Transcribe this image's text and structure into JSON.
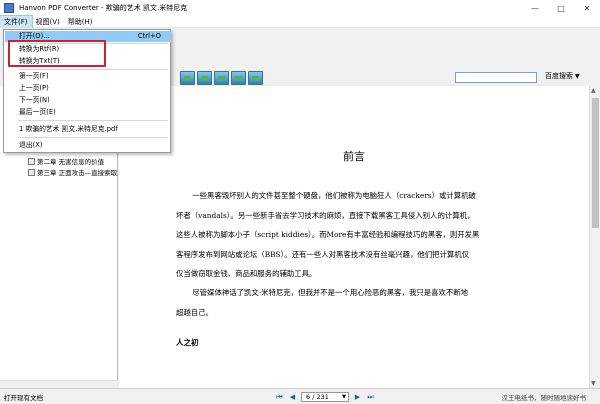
{
  "window": {
    "title": "Hanvon PDF Converter - 欺骗的艺术 凯文.米特尼克",
    "controls": [
      "—",
      "□",
      "✕"
    ]
  },
  "menubar": {
    "items": [
      {
        "label": "文件(F)"
      },
      {
        "label": "视图(V)"
      },
      {
        "label": "帮助(H)"
      }
    ]
  },
  "file_menu": {
    "open": {
      "label": "打开(O)...",
      "shortcut": "Ctrl+O"
    },
    "to_rtf": "转换为Rtf(R)",
    "to_txt": "转换为Txt(T)",
    "first_page": "第一页(F)",
    "prev_page": "上一页(P)",
    "next_page": "下一页(N)",
    "last_page": "最后一页(E)",
    "recent_file": "1 欺骗的艺术 凯文.米特尼克.pdf",
    "exit": "退出(X)"
  },
  "search": {
    "value": "",
    "button_label": "百度搜索"
  },
  "toc": {
    "items": [
      {
        "label": "第二章 无害信息的价值"
      },
      {
        "label": "第三章 正面攻击—直接索取"
      }
    ]
  },
  "document": {
    "heading": "前言",
    "paragraphs": [
      {
        "lines": [
          "一些黑客毁坏别人的文件甚至整个硬盘，他们被称为电脑狂人（crackers）或计算机破",
          "坏者（vandals）。另一些新手省去学习技术的麻烦，直接下载黑客工具侵入别人的计算机，",
          "这些人被称为脚本小子（script kiddies）。而More有丰富经验和编程技巧的黑客，则开发黑",
          "客程序发布到网站或论坛（BBS）。还有一些人对黑客技术没有丝毫兴趣，他们把计算机仅",
          "仅当做窃取金钱、商品和服务的辅助工具。"
        ]
      },
      {
        "lines": [
          "尽管媒体神话了凯文·米特尼克，但我并不是一个用心险恶的黑客，我只是喜欢不断地",
          "超越自己。"
        ]
      }
    ],
    "subheading": "人之初"
  },
  "statusbar": {
    "left_text": "打开现有文档",
    "page_display": "6 / 231",
    "right_text": "汉王电纸书，随时随地读好书"
  },
  "colors": {
    "menu_highlight": "#91c9f7",
    "annotation_box": "#d0202a"
  }
}
